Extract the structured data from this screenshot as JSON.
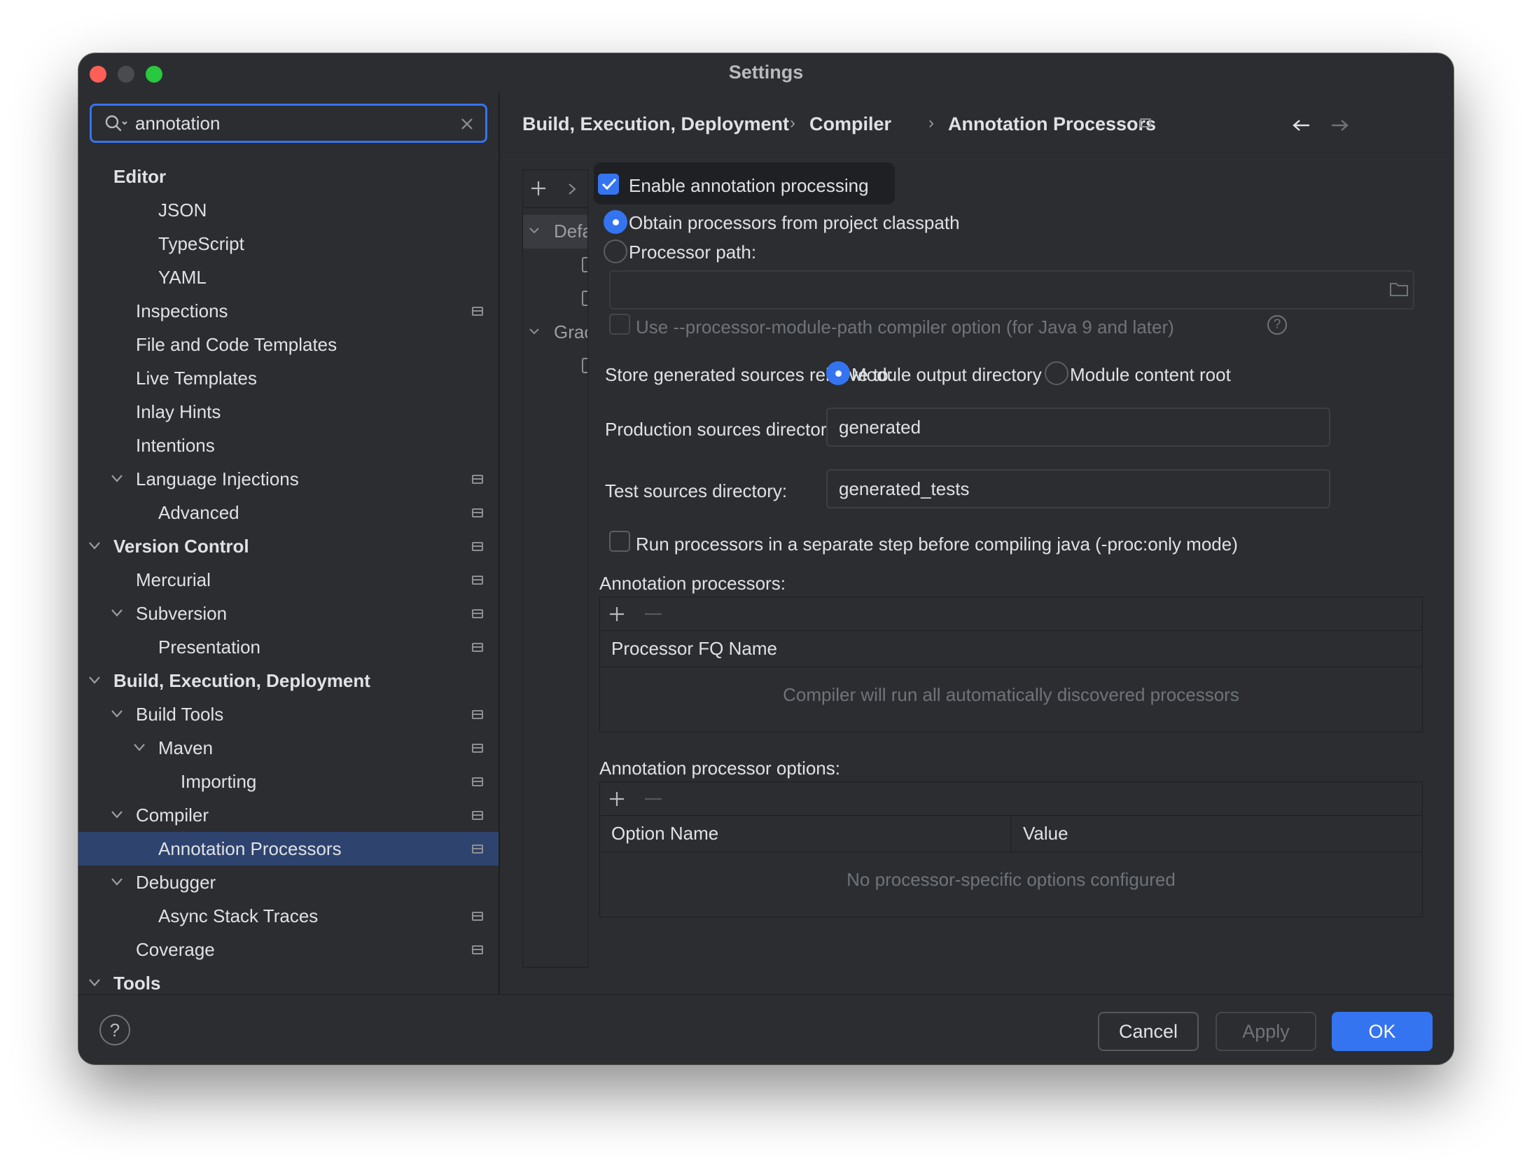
{
  "window": {
    "title": "Settings"
  },
  "search": {
    "value": "annotation"
  },
  "sidebar": {
    "items": [
      {
        "label": "Editor",
        "bold": true,
        "level": 0,
        "chevron": false,
        "project_icon": false
      },
      {
        "label": "JSON",
        "level": 2,
        "chevron": false,
        "project_icon": false
      },
      {
        "label": "TypeScript",
        "level": 2,
        "chevron": false,
        "project_icon": false
      },
      {
        "label": "YAML",
        "level": 2,
        "chevron": false,
        "project_icon": false
      },
      {
        "label": "Inspections",
        "level": 1,
        "chevron": false,
        "project_icon": true
      },
      {
        "label": "File and Code Templates",
        "level": 1,
        "chevron": false,
        "project_icon": false
      },
      {
        "label": "Live Templates",
        "level": 1,
        "chevron": false,
        "project_icon": false
      },
      {
        "label": "Inlay Hints",
        "level": 1,
        "chevron": false,
        "project_icon": false
      },
      {
        "label": "Intentions",
        "level": 1,
        "chevron": false,
        "project_icon": false
      },
      {
        "label": "Language Injections",
        "level": 1,
        "chevron": true,
        "project_icon": true
      },
      {
        "label": "Advanced",
        "level": 2,
        "chevron": false,
        "project_icon": true
      },
      {
        "label": "Version Control",
        "bold": true,
        "level": 0,
        "chevron": true,
        "project_icon": true
      },
      {
        "label": "Mercurial",
        "level": 1,
        "chevron": false,
        "project_icon": true
      },
      {
        "label": "Subversion",
        "level": 1,
        "chevron": true,
        "project_icon": true
      },
      {
        "label": "Presentation",
        "level": 2,
        "chevron": false,
        "project_icon": true
      },
      {
        "label": "Build, Execution, Deployment",
        "bold": true,
        "level": 0,
        "chevron": true,
        "project_icon": false
      },
      {
        "label": "Build Tools",
        "level": 1,
        "chevron": true,
        "project_icon": true
      },
      {
        "label": "Maven",
        "level": 2,
        "chevron": true,
        "project_icon": true
      },
      {
        "label": "Importing",
        "level": 3,
        "chevron": false,
        "project_icon": true
      },
      {
        "label": "Compiler",
        "level": 1,
        "chevron": true,
        "project_icon": true
      },
      {
        "label": "Annotation Processors",
        "level": 2,
        "chevron": false,
        "project_icon": true,
        "selected": true
      },
      {
        "label": "Debugger",
        "level": 1,
        "chevron": true,
        "project_icon": false
      },
      {
        "label": "Async Stack Traces",
        "level": 2,
        "chevron": false,
        "project_icon": true
      },
      {
        "label": "Coverage",
        "level": 1,
        "chevron": false,
        "project_icon": true
      },
      {
        "label": "Tools",
        "bold": true,
        "level": 0,
        "chevron": true,
        "project_icon": false
      }
    ]
  },
  "breadcrumb": {
    "items": [
      "Build, Execution, Deployment",
      "Compiler",
      "Annotation Processors"
    ],
    "separator": "›"
  },
  "profiles": {
    "rows": [
      {
        "label": "Defa",
        "chevron": true
      },
      {
        "label": "",
        "checkbox": true
      },
      {
        "label": "",
        "checkbox": true
      },
      {
        "label": "Grac",
        "chevron": true
      },
      {
        "label": "",
        "checkbox": true
      }
    ]
  },
  "form": {
    "enable_label": "Enable annotation processing",
    "enable_checked": true,
    "obtain_label": "Obtain processors from project classpath",
    "processor_path_label": "Processor path:",
    "processor_path_value": "",
    "module_path_label": "Use --processor-module-path compiler option (for Java 9 and later)",
    "store_label": "Store generated sources relative to:",
    "store_option_output": "Module output directory",
    "store_option_content": "Module content root",
    "production_label": "Production sources directory:",
    "production_value": "generated",
    "test_label": "Test sources directory:",
    "test_value": "generated_tests",
    "run_separate_label": "Run processors in a separate step before compiling java (-proc:only mode)",
    "processors_section": "Annotation processors:",
    "processors_column": "Processor FQ Name",
    "processors_empty": "Compiler will run all automatically discovered processors",
    "options_section": "Annotation processor options:",
    "options_col_name": "Option Name",
    "options_col_value": "Value",
    "options_empty": "No processor-specific options configured"
  },
  "footer": {
    "help": "?",
    "cancel": "Cancel",
    "apply": "Apply",
    "ok": "OK"
  },
  "colors": {
    "accent": "#3574f0",
    "selection": "#2e436e",
    "background": "#2b2d30"
  }
}
